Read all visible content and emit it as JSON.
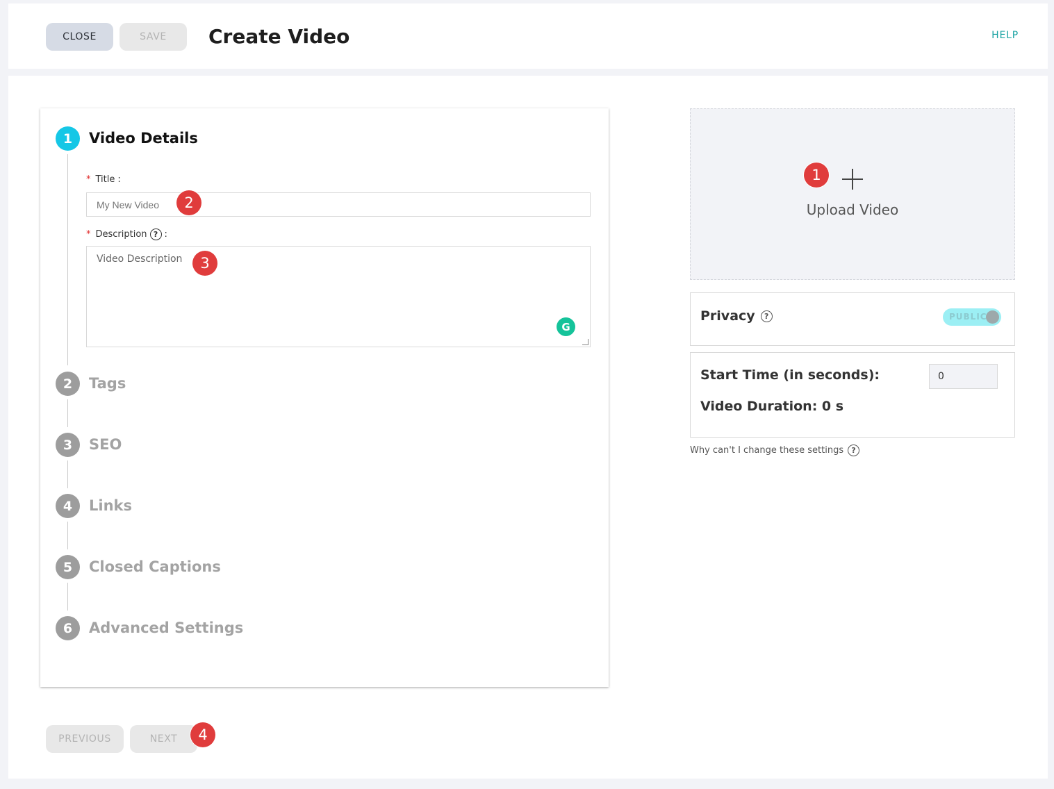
{
  "header": {
    "close_label": "CLOSE",
    "save_label": "SAVE",
    "title": "Create Video",
    "help_label": "HELP"
  },
  "steps": [
    {
      "number": "1",
      "label": "Video Details",
      "active": true
    },
    {
      "number": "2",
      "label": "Tags",
      "active": false
    },
    {
      "number": "3",
      "label": "SEO",
      "active": false
    },
    {
      "number": "4",
      "label": "Links",
      "active": false
    },
    {
      "number": "5",
      "label": "Closed Captions",
      "active": false
    },
    {
      "number": "6",
      "label": "Advanced Settings",
      "active": false
    }
  ],
  "form": {
    "required_marker": "*",
    "title_label": "Title",
    "title_placeholder": "My New Video",
    "description_label": "Description",
    "description_placeholder": "Video Description",
    "label_suffix": ":"
  },
  "upload": {
    "label": "Upload Video"
  },
  "privacy": {
    "label": "Privacy",
    "toggle_text": "PUBLIC"
  },
  "timing": {
    "start_time_label": "Start Time (in seconds):",
    "start_time_value": "0",
    "duration_label": "Video Duration: 0 s"
  },
  "settings_note": "Why can't I change these settings",
  "footer": {
    "previous_label": "PREVIOUS",
    "next_label": "NEXT"
  },
  "annotations": [
    "1",
    "2",
    "3",
    "4"
  ],
  "colors": {
    "accent": "#15c7e6",
    "help_link": "#1ba3a3",
    "badge": "#e03c3c",
    "toggle_bg": "#9ceff4",
    "grammarly": "#15c39a"
  },
  "icons": {
    "help": "question-circle-icon",
    "upload": "plus-icon",
    "grammarly": "grammarly-icon"
  }
}
